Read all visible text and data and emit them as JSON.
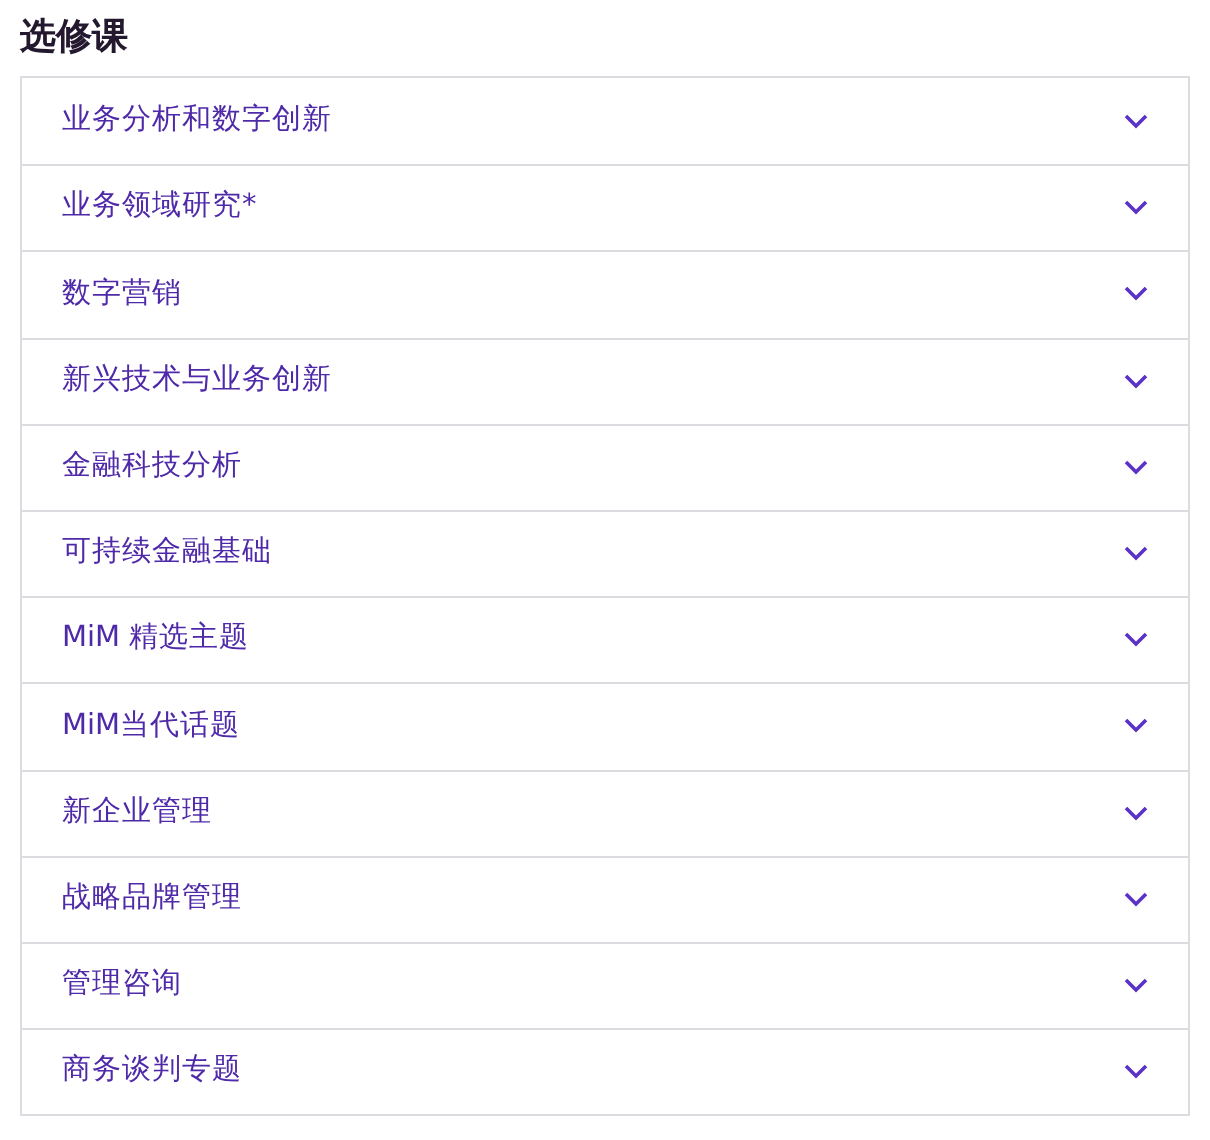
{
  "title": "选修课",
  "items": [
    {
      "label": "业务分析和数字创新",
      "expanded": false
    },
    {
      "label": "业务领域研究*",
      "expanded": false
    },
    {
      "label": "数字营销",
      "expanded": false
    },
    {
      "label": "新兴技术与业务创新",
      "expanded": false
    },
    {
      "label": "金融科技分析",
      "expanded": false
    },
    {
      "label": "可持续金融基础",
      "expanded": false
    },
    {
      "label": "MiM 精选主题",
      "expanded": false
    },
    {
      "label": "MiM当代话题",
      "expanded": false
    },
    {
      "label": "新企业管理",
      "expanded": false
    },
    {
      "label": "战略品牌管理",
      "expanded": false
    },
    {
      "label": "管理咨询",
      "expanded": false
    },
    {
      "label": "商务谈判专题",
      "expanded": false
    }
  ]
}
